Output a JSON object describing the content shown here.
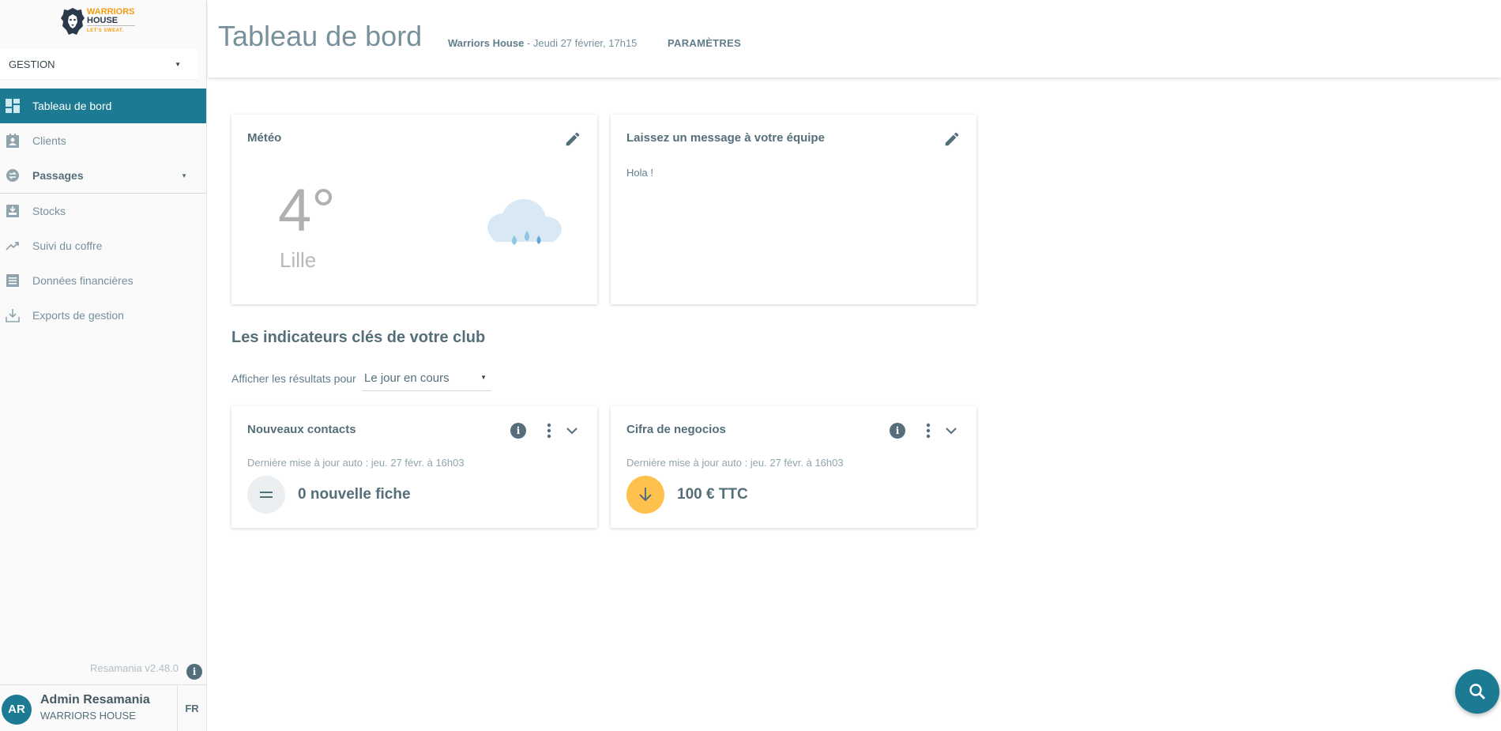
{
  "sidebar": {
    "logo": {
      "line1": "WARRIORS",
      "line2": "HOUSE",
      "line3": "LET'S SWEAT."
    },
    "section": "GESTION",
    "items": [
      {
        "label": "Tableau de bord",
        "icon": "dashboard-icon"
      },
      {
        "label": "Clients",
        "icon": "contact-card-icon"
      },
      {
        "label": "Passages",
        "icon": "swap-icon"
      },
      {
        "label": "Stocks",
        "icon": "inventory-icon"
      },
      {
        "label": "Suivi du coffre",
        "icon": "trending-up-icon"
      },
      {
        "label": "Données financières",
        "icon": "list-icon"
      },
      {
        "label": "Exports de gestion",
        "icon": "download-icon"
      }
    ],
    "version": "Resamania v2.48.0",
    "user": {
      "initials": "AR",
      "name": "Admin Resamania",
      "club": "WARRIORS HOUSE",
      "lang": "FR"
    }
  },
  "header": {
    "title": "Tableau de bord",
    "club": "Warriors House",
    "datetime": " - Jeudi 27 février, 17h15",
    "params": "PARAMÈTRES"
  },
  "weather": {
    "title": "Météo",
    "temp": "4°",
    "city": "Lille"
  },
  "team_message": {
    "title": "Laissez un message à votre équipe",
    "text": "Hola !"
  },
  "indicators": {
    "title": "Les indicateurs clés de votre club",
    "filter_label": "Afficher les résultats pour",
    "filter_value": "Le jour en cours",
    "cards": [
      {
        "title": "Nouveaux contacts",
        "meta": "Dernière mise à jour auto : jeu. 27 févr. à 16h03",
        "value": "0 nouvelle fiche"
      },
      {
        "title": "Cifra de negocios",
        "meta": "Dernière mise à jour auto : jeu. 27 févr. à 16h03",
        "value": "100 € TTC"
      }
    ]
  },
  "colors": {
    "primary": "#1c7a93",
    "accent": "#ffc14d"
  }
}
